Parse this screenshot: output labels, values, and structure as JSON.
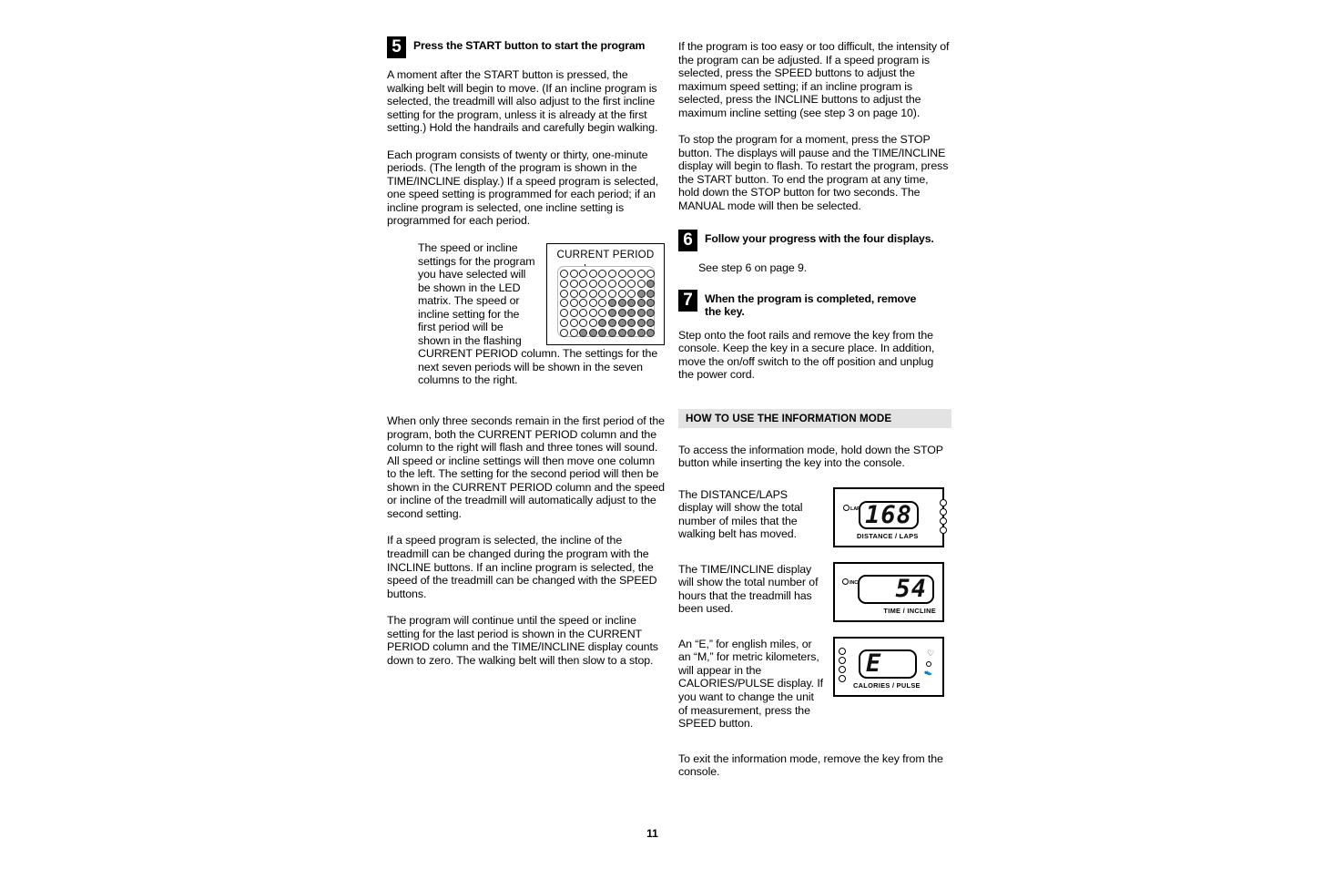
{
  "page": {
    "number": "11"
  },
  "left_column": {
    "step5": {
      "number": "5",
      "title": "Press the START button to start the program",
      "paragraphs": [
        "A moment after the START button is pressed, the walking belt will begin to move. (If an incline program is selected, the treadmill will also adjust to the first incline setting for the program, unless it is already at the first setting.) Hold the handrails and carefully begin walking.",
        "Each program consists of twenty or thirty, one-minute periods. (The length of the program is shown in the TIME/INCLINE display.) If a speed program is selected, one speed setting is programmed for each period; if an incline program is selected, one incline setting is programmed for each period."
      ],
      "wrap_paragraph": "The speed or incline settings for the program you have selected will be shown in the LED matrix. The speed or incline setting for the first period will be shown in the flashing CURRENT PERIOD column. The settings for the next seven periods will be shown in the seven columns to the right.",
      "paragraphs_after": [
        "When only three seconds remain in the first period of the program, both the CURRENT PERIOD column and the column to the right will flash and three tones will sound. All speed or incline settings will then move one column to the left. The setting for the second period will then be shown in the CURRENT PERIOD column and the speed or incline of the treadmill will automatically adjust to the second setting.",
        "If a speed program is selected, the incline of the treadmill can be changed during the program with the INCLINE buttons. If an incline program is selected, the speed of the treadmill can be changed with the SPEED buttons.",
        "The program will continue until the speed or incline setting for the last period is shown in the CURRENT PERIOD column and the TIME/INCLINE display counts down to zero. The walking belt will then slow to a stop."
      ]
    },
    "led_figure": {
      "caption": "CURRENT PERIOD",
      "columns": 10,
      "rows": 7,
      "pointer_column": 3,
      "matrix": [
        [
          0,
          0,
          0,
          0,
          0,
          0,
          0,
          0,
          0,
          0
        ],
        [
          0,
          0,
          0,
          0,
          0,
          0,
          0,
          0,
          0,
          1
        ],
        [
          0,
          0,
          0,
          0,
          0,
          0,
          0,
          0,
          1,
          1
        ],
        [
          0,
          0,
          0,
          0,
          0,
          1,
          1,
          1,
          1,
          1
        ],
        [
          0,
          0,
          0,
          0,
          0,
          1,
          1,
          1,
          1,
          1
        ],
        [
          0,
          0,
          0,
          0,
          1,
          1,
          1,
          1,
          1,
          1
        ],
        [
          0,
          0,
          1,
          1,
          1,
          1,
          1,
          1,
          1,
          1
        ]
      ]
    }
  },
  "right_column": {
    "intro_paragraphs": [
      "If the program is too easy or too difficult, the intensity of the program can be adjusted. If a speed program is selected, press the SPEED buttons to adjust the maximum speed setting; if an incline program is selected, press the INCLINE buttons to adjust the maximum incline setting (see step 3 on page 10).",
      "To stop the program for a moment, press the STOP button. The displays will pause and the TIME/INCLINE display will begin to flash. To restart the program, press the START button. To end the program at any time, hold down the STOP button for two seconds. The MANUAL mode will then be selected."
    ],
    "step6": {
      "number": "6",
      "title": "Follow your progress with the four displays.",
      "body": "See step 6 on page 9."
    },
    "step7": {
      "number": "7",
      "title": "When the program is completed, remove the key.",
      "body": "Step onto the foot rails and remove the key from the console. Keep the key in a secure place. In addition, move the on/off switch to the off position and unplug the power cord."
    },
    "info_section": {
      "header": "HOW TO USE THE INFORMATION MODE",
      "intro": "To access the information mode, hold down the STOP button while inserting the key into the console.",
      "displays": [
        {
          "text": "The DISTANCE/LAPS display will show the total number of miles that the walking belt has moved.",
          "value": "168",
          "label": "DISTANCE / LAPS",
          "indicator_label": "LAPS"
        },
        {
          "text": "The TIME/INCLINE display will show the total number of hours that the treadmill has been used.",
          "value": "54",
          "label": "TIME / INCLINE",
          "indicator_label": "INCL"
        },
        {
          "text": "An “E,” for english miles, or an “M,” for metric kilometers, will appear in the CALORIES/PULSE display. If you want to change the unit of measurement, press the SPEED     button.",
          "value": "E",
          "label": "CALORIES / PULSE",
          "indicator_label": ""
        }
      ],
      "outro": "To exit the information mode, remove the key from the console."
    }
  }
}
